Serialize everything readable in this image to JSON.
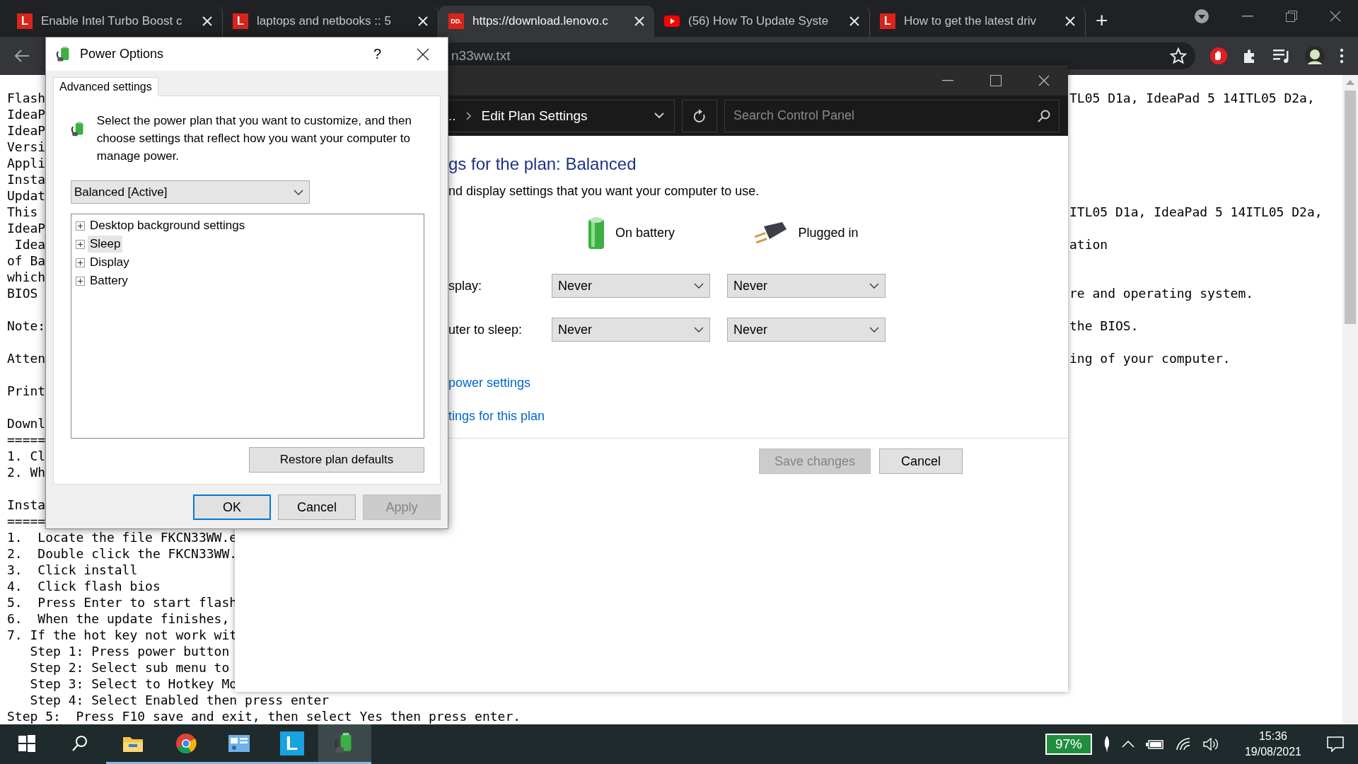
{
  "browser": {
    "tabs": [
      {
        "title": "Enable Intel Turbo Boost c",
        "kind": "letter",
        "favicon": "L",
        "selected": false
      },
      {
        "title": "laptops and netbooks :: 5",
        "kind": "letter",
        "favicon": "L",
        "selected": false
      },
      {
        "title": "https://download.lenovo.c",
        "kind": "letter",
        "favicon": "DD.",
        "selected": true
      },
      {
        "title": "(56) How To Update Syste",
        "kind": "youtube",
        "selected": false
      },
      {
        "title": "How to get the latest driv",
        "kind": "letter",
        "favicon": "L",
        "selected": false
      }
    ],
    "new_tab": "+",
    "address": "n33ww.txt"
  },
  "page": {
    "paragraphs": [
      [
        {
          "left": "Flash",
          "right": "TL05 D1a, IdeaPad 5 14ITL05 D2a,"
        },
        {
          "left": "IdeaP"
        },
        {
          "left": "IdeaP"
        },
        {
          "left": "Versi"
        },
        {
          "left": "Appli"
        },
        {
          "left": "Insta"
        },
        {
          "left": "Updat"
        },
        {
          "left": "This",
          "right": "ITL05 D1a, IdeaPad 5 14ITL05 D2a,"
        },
        {
          "left": "IdeaP"
        },
        {
          "left": " Idea",
          "right": "ation"
        },
        {
          "left": "of Ba"
        },
        {
          "left": "which"
        },
        {
          "left": "BIOS",
          "right": "re and operating system."
        }
      ],
      [
        {
          "left": "Note:",
          "right": "the BIOS."
        }
      ],
      [
        {
          "left": "Atten",
          "right": "ing of your computer."
        }
      ],
      [
        {
          "left": "Print"
        }
      ],
      [
        {
          "left": "Downl"
        },
        {
          "left": "====="
        },
        {
          "left": "1. Cl"
        },
        {
          "left": "2. Wh"
        }
      ],
      [
        {
          "left": "Insta"
        },
        {
          "left": "====="
        },
        {
          "left": "1.  Locate the file FKCN33WW.e"
        },
        {
          "left": "2.  Double click the FKCN33WW."
        },
        {
          "left": "3.  Click install"
        },
        {
          "left": "4.  Click flash bios"
        },
        {
          "left": "5.  Press Enter to start flash"
        },
        {
          "left": "6.  When the update finishes,"
        },
        {
          "left": "7. If the hot key not work wit"
        },
        {
          "left": "   Step 1: Press power button"
        },
        {
          "left": "   Step 2: Select sub menu to"
        },
        {
          "left": "   Step 3: Select to Hotkey Mo"
        },
        {
          "left": "   Step 4: Select Enabled then press enter"
        },
        {
          "left": "Step 5:  Press F10 save and exit, then select Yes then press enter."
        }
      ]
    ]
  },
  "control_panel": {
    "breadcrumb_prefix": "..",
    "breadcrumb": "Edit Plan Settings",
    "search_placeholder": "Search Control Panel",
    "heading": "gs for the plan: Balanced",
    "subtitle": "nd display settings that you want your computer to use.",
    "columns": [
      {
        "label": "On battery",
        "kind": "battery"
      },
      {
        "label": "Plugged in",
        "kind": "plug"
      }
    ],
    "rows": [
      {
        "label": "splay:",
        "values": [
          "Never",
          "Never"
        ]
      },
      {
        "label": "uter to sleep:",
        "values": [
          "Never",
          "Never"
        ]
      }
    ],
    "links": [
      "power settings",
      "tings for this plan"
    ],
    "buttons": [
      {
        "label": "Save changes",
        "disabled": true
      },
      {
        "label": "Cancel",
        "disabled": false
      }
    ]
  },
  "dialog": {
    "title": "Power Options",
    "help": "?",
    "tab": "Advanced settings",
    "description": "Select the power plan that you want to customize, and then choose settings that reflect how you want your computer to manage power.",
    "plan": "Balanced [Active]",
    "tree": [
      {
        "label": "Desktop background settings",
        "expanded": false,
        "selected": false
      },
      {
        "label": "Sleep",
        "expanded": false,
        "selected": true
      },
      {
        "label": "Display",
        "expanded": false,
        "selected": false
      },
      {
        "label": "Battery",
        "expanded": false,
        "selected": false
      }
    ],
    "restore": "Restore plan defaults",
    "buttons": [
      {
        "label": "OK",
        "default": true,
        "disabled": false
      },
      {
        "label": "Cancel",
        "default": false,
        "disabled": false
      },
      {
        "label": "Apply",
        "default": false,
        "disabled": true
      }
    ]
  },
  "taskbar": {
    "apps": [
      {
        "kind": "start",
        "running": false,
        "selected": false
      },
      {
        "kind": "search",
        "running": false,
        "selected": false
      },
      {
        "kind": "folder",
        "running": true,
        "selected": false
      },
      {
        "kind": "chrome",
        "running": true,
        "selected": false
      },
      {
        "kind": "control-panel",
        "running": true,
        "selected": false
      },
      {
        "kind": "letter",
        "label": "L",
        "running": true,
        "selected": false
      },
      {
        "kind": "power",
        "running": true,
        "selected": true
      }
    ],
    "battery": "97%",
    "time": "15:36",
    "date": "19/08/2021"
  }
}
